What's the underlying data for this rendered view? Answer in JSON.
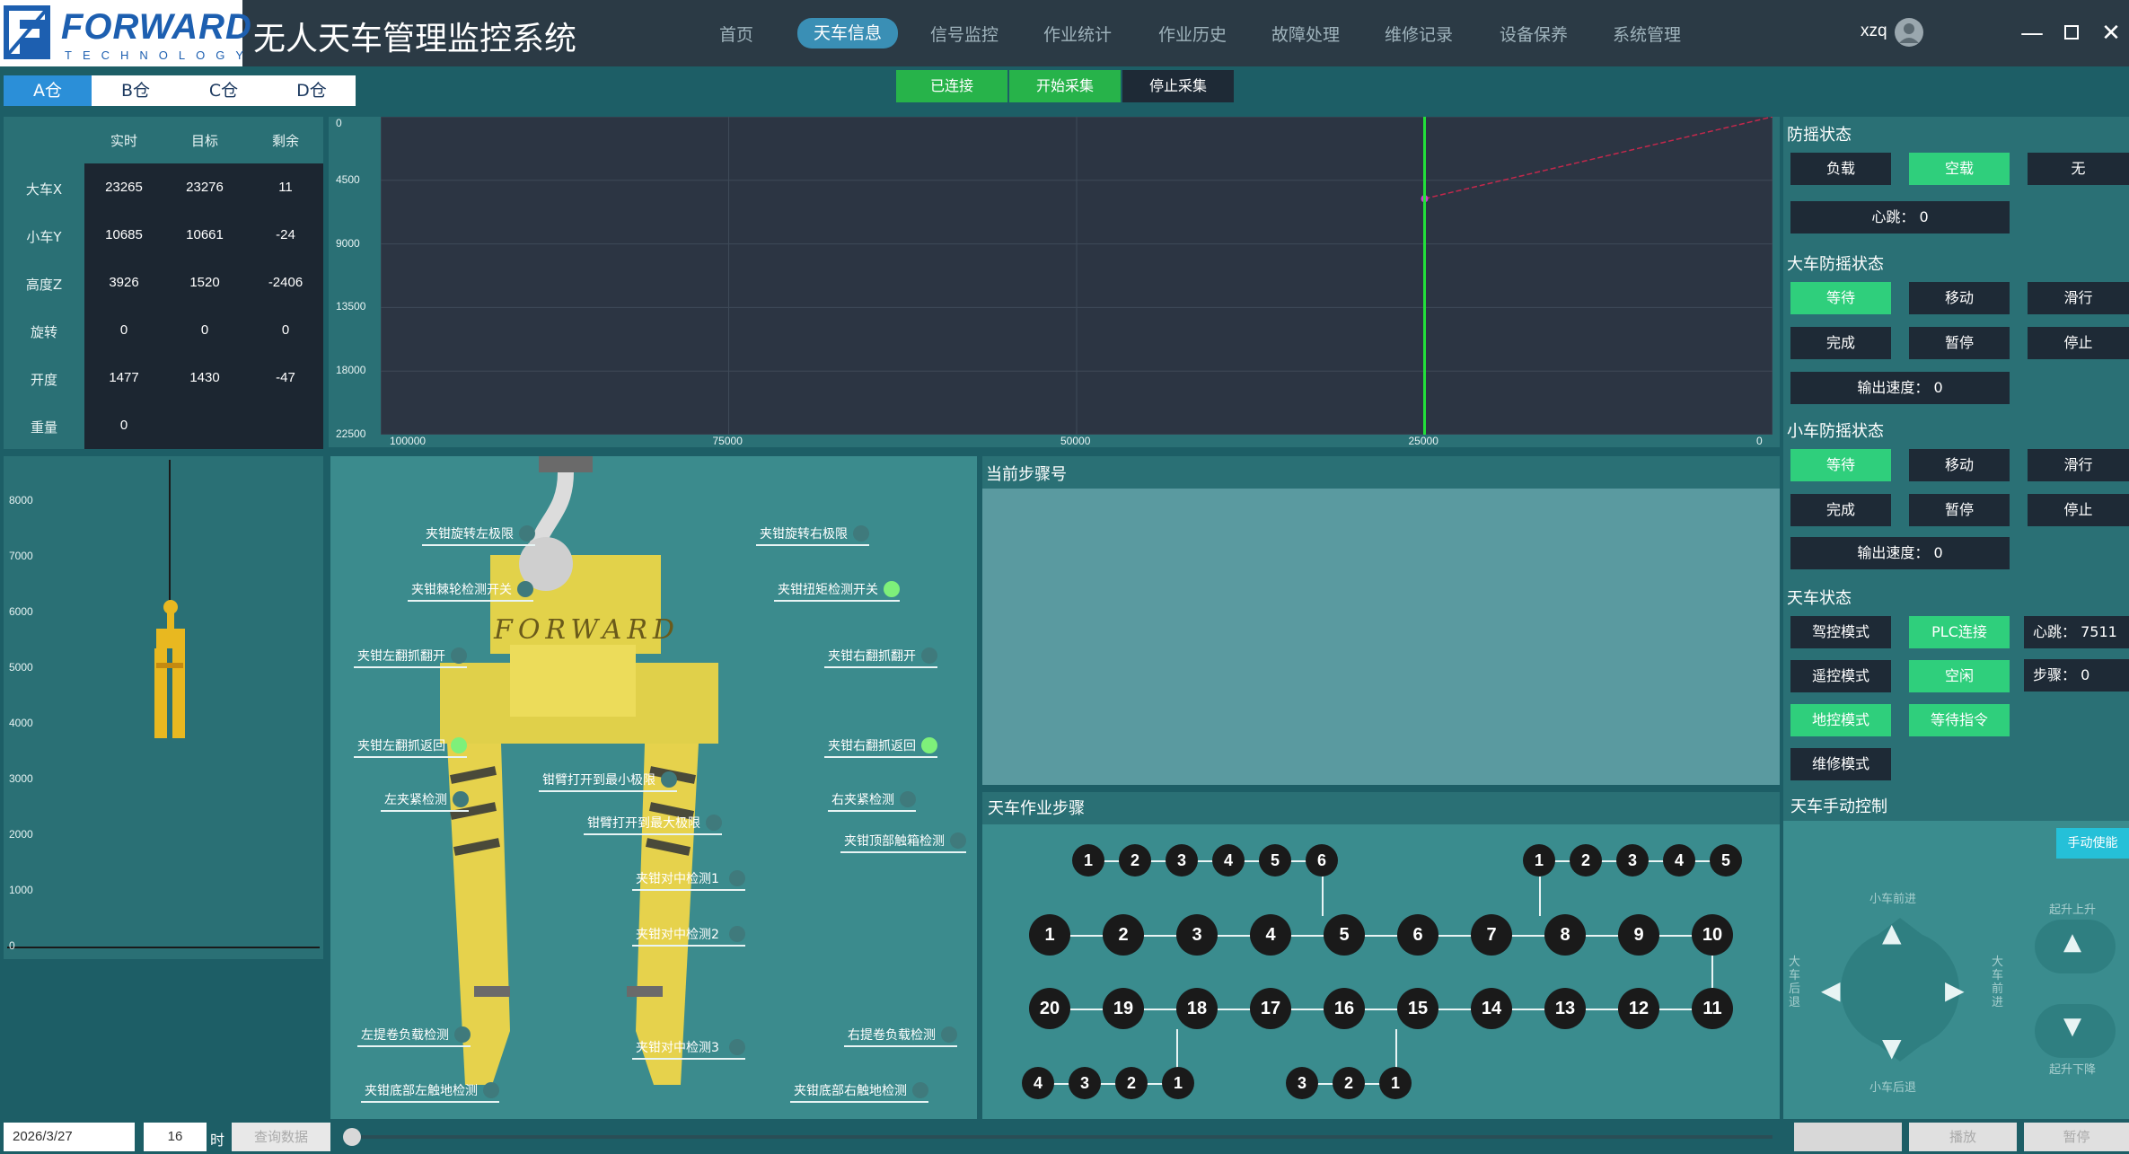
{
  "header": {
    "logo_text": "FORWARD",
    "logo_sub": "TECHNOLOGY",
    "title": "无人天车管理监控系统",
    "nav": [
      "首页",
      "天车信息",
      "信号监控",
      "作业统计",
      "作业历史",
      "故障处理",
      "维修记录",
      "设备保养",
      "系统管理"
    ],
    "active_nav": "天车信息",
    "user": "xzq",
    "window_controls": [
      "minimize-icon",
      "maximize-icon",
      "close-icon"
    ]
  },
  "warehouse_tabs": [
    "A仓",
    "B仓",
    "C仓",
    "D仓"
  ],
  "connection": {
    "connected": "已连接",
    "start": "开始采集",
    "stop": "停止采集"
  },
  "table": {
    "headers": [
      "实时",
      "目标",
      "剩余"
    ],
    "rows": [
      {
        "label": "大车X",
        "values": [
          "23265",
          "23276",
          "11"
        ]
      },
      {
        "label": "小车Y",
        "values": [
          "10685",
          "10661",
          "-24"
        ]
      },
      {
        "label": "高度Z",
        "values": [
          "3926",
          "1520",
          "-2406"
        ]
      },
      {
        "label": "旋转",
        "values": [
          "0",
          "0",
          "0"
        ]
      },
      {
        "label": "开度",
        "values": [
          "1477",
          "1430",
          "-47"
        ]
      },
      {
        "label": "重量",
        "values": [
          "0",
          "",
          ""
        ]
      }
    ]
  },
  "chart_data": {
    "type": "line",
    "y_ticks": [
      "0",
      "4500",
      "9000",
      "13500",
      "18000",
      "22500"
    ],
    "x_ticks": [
      "100000",
      "75000",
      "50000",
      "25000",
      "0"
    ],
    "xlim": [
      100000,
      0
    ],
    "ylim": [
      0,
      22500
    ],
    "series": [
      {
        "x": [
          25000,
          0
        ],
        "y": [
          5800,
          0
        ]
      }
    ],
    "cursor_x": 25000,
    "colors": {
      "series": "#c4284c",
      "cursor": "#22e03a",
      "point": "#d040d0"
    }
  },
  "z_axis": {
    "ticks": [
      "8000",
      "7000",
      "6000",
      "5000",
      "4000",
      "3000",
      "2000",
      "1000",
      "0"
    ]
  },
  "gripper": {
    "brand": "FORWARD",
    "labels": [
      {
        "text": "夹钳旋转左极限",
        "on": false
      },
      {
        "text": "夹钳旋转右极限",
        "on": false
      },
      {
        "text": "夹钳棘轮检测开关",
        "on": false
      },
      {
        "text": "夹钳扭矩检测开关",
        "on": true
      },
      {
        "text": "夹钳左翻抓翻开",
        "on": false
      },
      {
        "text": "夹钳右翻抓翻开",
        "on": false
      },
      {
        "text": "夹钳左翻抓返回",
        "on": true
      },
      {
        "text": "夹钳右翻抓返回",
        "on": true
      },
      {
        "text": "钳臂打开到最小极限",
        "on": false
      },
      {
        "text": "左夹紧检测",
        "on": false
      },
      {
        "text": "右夹紧检测",
        "on": false
      },
      {
        "text": "钳臂打开到最大极限",
        "on": false
      },
      {
        "text": "夹钳顶部触箱检测",
        "on": false
      },
      {
        "text": "夹钳对中检测1",
        "on": false
      },
      {
        "text": "夹钳对中检测2",
        "on": false
      },
      {
        "text": "左提卷负载检测",
        "on": false
      },
      {
        "text": "右提卷负载检测",
        "on": false
      },
      {
        "text": "夹钳对中检测3",
        "on": false
      },
      {
        "text": "夹钳底部左触地检测",
        "on": false
      },
      {
        "text": "夹钳底部右触地检测",
        "on": false
      }
    ]
  },
  "step_panel": {
    "title": "当前步骤号"
  },
  "flow": {
    "title": "天车作业步骤",
    "top_left": [
      "1",
      "2",
      "3",
      "4",
      "5",
      "6"
    ],
    "top_right": [
      "1",
      "2",
      "3",
      "4",
      "5"
    ],
    "row1": [
      "1",
      "2",
      "3",
      "4",
      "5",
      "6",
      "7",
      "8",
      "9",
      "10"
    ],
    "row2": [
      "20",
      "19",
      "18",
      "17",
      "16",
      "15",
      "14",
      "13",
      "12",
      "11"
    ],
    "bottom_left": [
      "4",
      "3",
      "2",
      "1"
    ],
    "bottom_mid": [
      "3",
      "2",
      "1"
    ]
  },
  "right": {
    "anti_sway": {
      "title": "防摇状态",
      "buttons": [
        {
          "text": "负载",
          "on": false
        },
        {
          "text": "空载",
          "on": true
        },
        {
          "text": "无",
          "on": false
        }
      ],
      "heartbeat": "心跳： 0"
    },
    "big_car": {
      "title": "大车防摇状态",
      "buttons": [
        {
          "text": "等待",
          "on": true
        },
        {
          "text": "移动",
          "on": false
        },
        {
          "text": "滑行",
          "on": false
        },
        {
          "text": "完成",
          "on": false
        },
        {
          "text": "暂停",
          "on": false
        },
        {
          "text": "停止",
          "on": false
        }
      ],
      "speed": "输出速度： 0"
    },
    "small_car": {
      "title": "小车防摇状态",
      "buttons": [
        {
          "text": "等待",
          "on": true
        },
        {
          "text": "移动",
          "on": false
        },
        {
          "text": "滑行",
          "on": false
        },
        {
          "text": "完成",
          "on": false
        },
        {
          "text": "暂停",
          "on": false
        },
        {
          "text": "停止",
          "on": false
        }
      ],
      "speed": "输出速度： 0"
    },
    "crane": {
      "title": "天车状态",
      "modes": [
        {
          "text": "驾控模式",
          "on": false
        },
        {
          "text": "遥控模式",
          "on": false
        },
        {
          "text": "地控模式",
          "on": true
        },
        {
          "text": "维修模式",
          "on": false
        }
      ],
      "status": [
        {
          "text": "PLC连接",
          "on": true
        },
        {
          "text": "空闲",
          "on": true
        },
        {
          "text": "等待指令",
          "on": true
        }
      ],
      "heartbeat": "心跳： 7511",
      "step": "步骤： 0"
    },
    "manual": {
      "title": "天车手动控制",
      "enable": "手动使能",
      "up": "小车前进",
      "down": "小车后退",
      "left": "大车后退",
      "right": "大车前进",
      "lift_up": "起升上升",
      "lift_down": "起升下降"
    }
  },
  "bottom": {
    "date": "2026/3/27",
    "hour": "16",
    "hour_unit": "时",
    "query": "查询数据",
    "play": "播放",
    "pause": "暂停"
  }
}
